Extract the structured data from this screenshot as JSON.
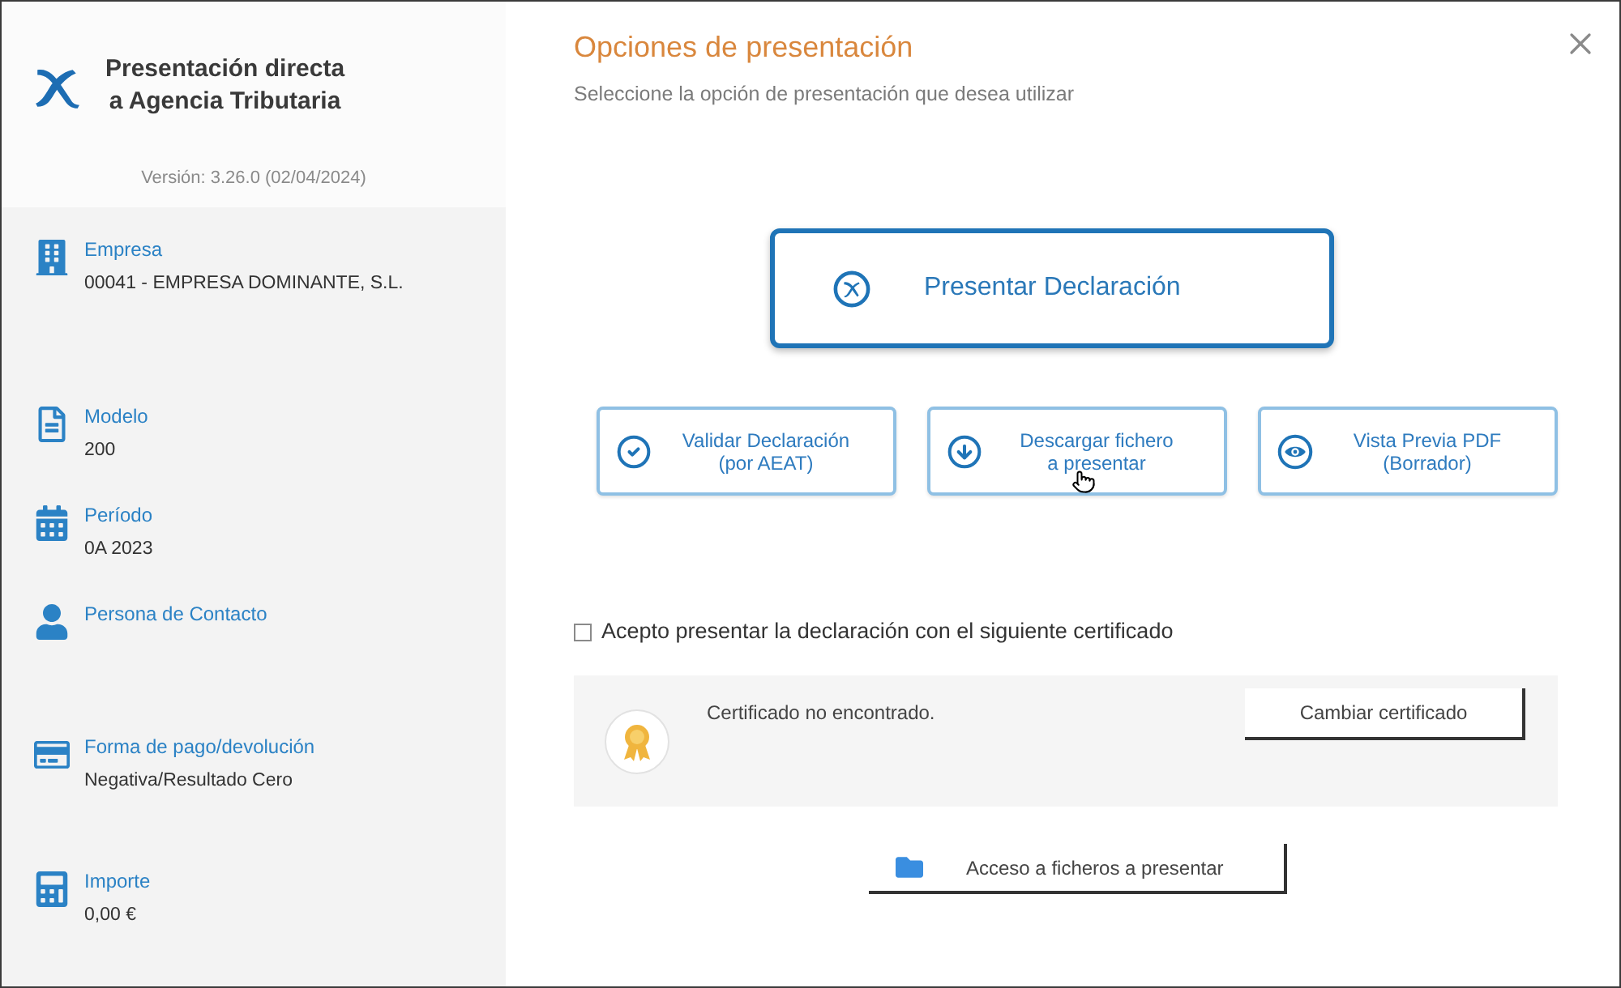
{
  "sidebar": {
    "title_lines": [
      "Presentación directa",
      "a Agencia Tributaria"
    ],
    "version": "Versión: 3.26.0 (02/04/2024)",
    "items": [
      {
        "label": "Empresa",
        "value": "00041 - EMPRESA DOMINANTE, S.L."
      },
      {
        "label": "Modelo",
        "value": "200"
      },
      {
        "label": "Período",
        "value": "0A 2023"
      },
      {
        "label": "Persona de Contacto"
      },
      {
        "label": "Forma de pago/devolución",
        "value": "Negativa/Resultado Cero"
      },
      {
        "label": "Importe",
        "value": "0,00 €"
      }
    ]
  },
  "dialog": {
    "title": "Opciones de presentación",
    "subtitle": "Seleccione la opción de presentación que desea utilizar",
    "primary_action": "Presentar Declaración",
    "actions": [
      {
        "label_lines": [
          "Validar Declaración",
          "(por AEAT)"
        ],
        "hovered": false
      },
      {
        "label_lines": [
          "Descargar fichero",
          "a presentar"
        ],
        "hovered": true
      },
      {
        "label_lines": [
          "Vista Previa PDF",
          "(Borrador)"
        ],
        "hovered": false
      }
    ],
    "accept_checkbox": {
      "label": "Acepto presentar la declaración con el siguiente certificado",
      "checked": false
    },
    "certificate": {
      "status": "Certificado no encontrado.",
      "button": "Cambiar certificado"
    },
    "files_button": "Acceso a ficheros a presentar"
  }
}
